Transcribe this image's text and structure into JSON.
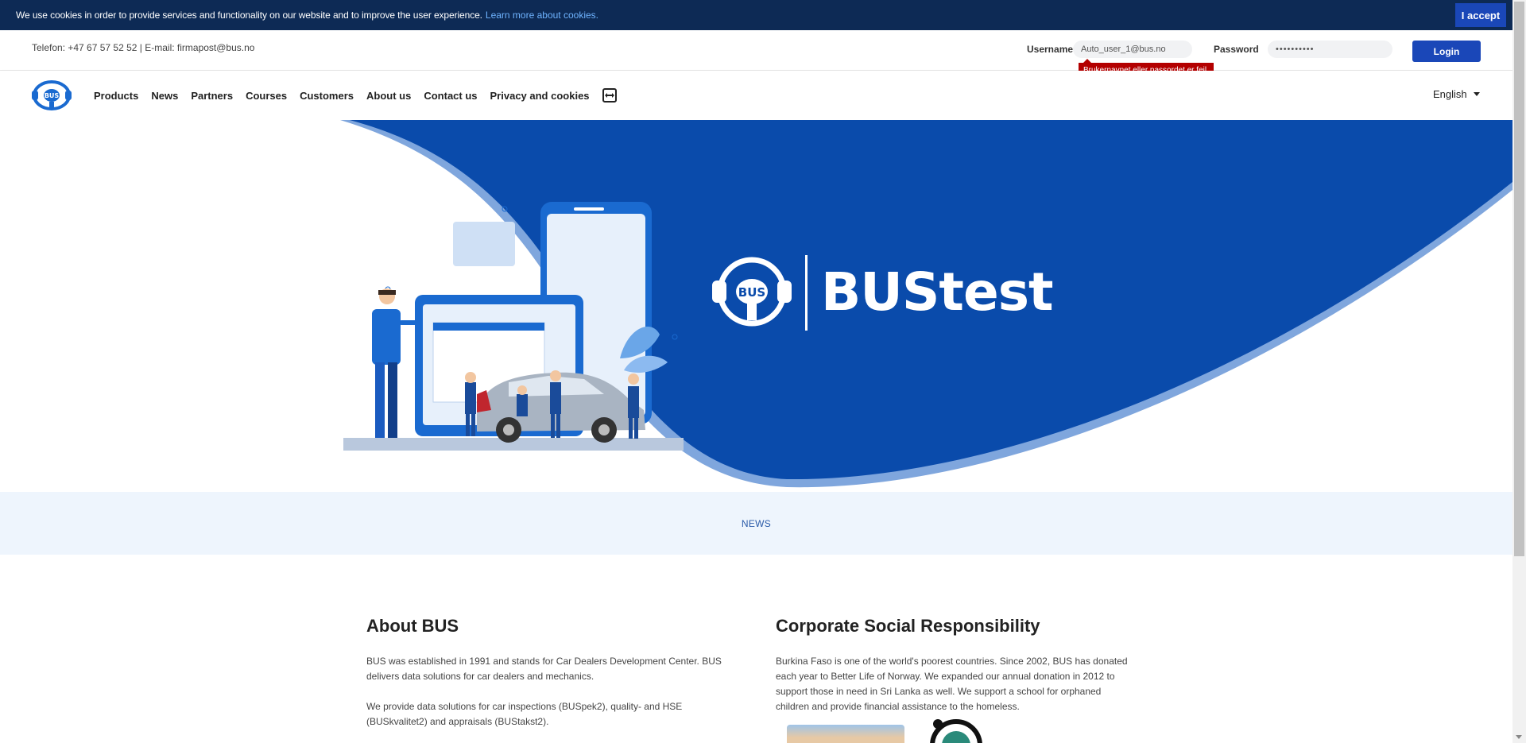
{
  "cookie": {
    "text": "We use cookies in order to provide services and functionality on our website and to improve the user experience.",
    "link": "Learn more about cookies.",
    "accept": "I accept"
  },
  "topbar": {
    "contact": "Telefon: +47 67 57 52 52 | E-mail: firmapost@bus.no",
    "username_label": "Username",
    "username_value": "Auto_user_1@bus.no",
    "password_label": "Password",
    "password_value": "••••••••••",
    "login_button": "Login",
    "error": "Brukernavnet eller passordet er feil."
  },
  "nav": {
    "logo_text": "BUS",
    "items": [
      "Products",
      "News",
      "Partners",
      "Courses",
      "Customers",
      "About us",
      "Contact us",
      "Privacy and cookies"
    ],
    "language": "English"
  },
  "hero": {
    "brand_small": "BUS",
    "title": "BUStest"
  },
  "news": {
    "label": "NEWS"
  },
  "about": {
    "title": "About BUS",
    "p1": "BUS was established in 1991 and stands for Car Dealers Development Center. BUS delivers data solutions for car dealers and mechanics.",
    "p2": "We provide data solutions for car inspections (BUSpek2), quality- and HSE (BUSkvalitet2) and appraisals (BUStakst2)."
  },
  "csr": {
    "title": "Corporate Social Responsibility",
    "p1": "Burkina Faso is one of the world's poorest countries. Since 2002, BUS has donated each year to Better Life of Norway. We expanded our annual donation in 2012 to support those in need in Sri Lanka as well. We support a school for orphaned children and provide financial assistance to the homeless."
  },
  "colors": {
    "cookie_bg": "#0d2a55",
    "brand_blue": "#0a4bab",
    "button_blue": "#1a47b8",
    "error_red": "#b30000",
    "news_bg": "#eef5fd"
  }
}
